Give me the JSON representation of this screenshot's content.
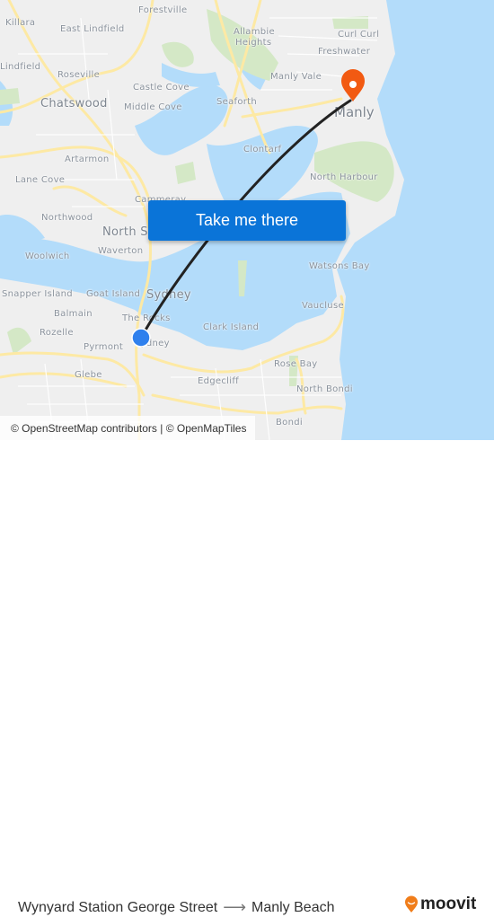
{
  "map": {
    "places": [
      {
        "id": "killara",
        "label": "Killara"
      },
      {
        "id": "forestville",
        "label": "Forestville"
      },
      {
        "id": "east-lindfield",
        "label": "East Lindfield"
      },
      {
        "id": "allambie-heights-1",
        "label": "Allambie"
      },
      {
        "id": "allambie-heights-2",
        "label": "Heights"
      },
      {
        "id": "curl-curl",
        "label": "Curl Curl"
      },
      {
        "id": "freshwater",
        "label": "Freshwater"
      },
      {
        "id": "lindfield",
        "label": "Lindfield"
      },
      {
        "id": "roseville",
        "label": "Roseville"
      },
      {
        "id": "manly-vale",
        "label": "Manly Vale"
      },
      {
        "id": "castle-cove",
        "label": "Castle Cove"
      },
      {
        "id": "chatswood",
        "label": "Chatswood"
      },
      {
        "id": "middle-cove",
        "label": "Middle Cove"
      },
      {
        "id": "seaforth",
        "label": "Seaforth"
      },
      {
        "id": "manly",
        "label": "Manly"
      },
      {
        "id": "clontarf",
        "label": "Clontarf"
      },
      {
        "id": "artarmon",
        "label": "Artarmon"
      },
      {
        "id": "north-harbour",
        "label": "North Harbour"
      },
      {
        "id": "lane-cove",
        "label": "Lane Cove"
      },
      {
        "id": "cammeray",
        "label": "Cammeray"
      },
      {
        "id": "northwood",
        "label": "Northwood"
      },
      {
        "id": "north-sydney",
        "label": "North Sydney"
      },
      {
        "id": "waverton",
        "label": "Waverton"
      },
      {
        "id": "woolwich",
        "label": "Woolwich"
      },
      {
        "id": "watsons-bay",
        "label": "Watsons Bay"
      },
      {
        "id": "snapper-island",
        "label": "Snapper Island"
      },
      {
        "id": "goat-island",
        "label": "Goat Island"
      },
      {
        "id": "sydney",
        "label": "Sydney"
      },
      {
        "id": "vaucluse",
        "label": "Vaucluse"
      },
      {
        "id": "balmain",
        "label": "Balmain"
      },
      {
        "id": "the-rocks",
        "label": "The Rocks"
      },
      {
        "id": "rozelle",
        "label": "Rozelle"
      },
      {
        "id": "clark-island",
        "label": "Clark Island"
      },
      {
        "id": "pyrmont",
        "label": "Pyrmont"
      },
      {
        "id": "sydney-cbd",
        "label": "Sydney"
      },
      {
        "id": "rose-bay",
        "label": "Rose Bay"
      },
      {
        "id": "glebe",
        "label": "Glebe"
      },
      {
        "id": "edgecliff",
        "label": "Edgecliff"
      },
      {
        "id": "north-bondi",
        "label": "North Bondi"
      },
      {
        "id": "bondi",
        "label": "Bondi"
      }
    ],
    "cta_label": "Take me there",
    "attribution": "© OpenStreetMap contributors | © OpenMapTiles",
    "colors": {
      "water": "#b3dcfa",
      "land": "#efefef",
      "park": "#d4e8c6",
      "road": "#fde9a4",
      "route": "#222222",
      "origin": "#2f80ed",
      "destination": "#f25a12",
      "cta": "#0a74d8"
    }
  },
  "footer": {
    "origin": "Wynyard Station George Street",
    "arrow": "⟶",
    "destination": "Manly Beach",
    "brand": "moovit",
    "brand_color": "#f07d1a"
  }
}
